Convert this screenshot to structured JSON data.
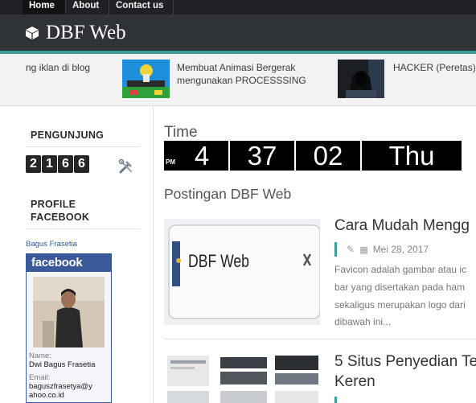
{
  "nav": {
    "items": [
      {
        "label": "Home",
        "active": true
      },
      {
        "label": "About",
        "active": false
      },
      {
        "label": "Contact us",
        "active": false
      }
    ]
  },
  "header": {
    "title": "DBF Web",
    "icon": "cube-icon"
  },
  "slider": {
    "items": [
      {
        "caption": "ng iklan di blog"
      },
      {
        "caption_line1": "Membuat Animasi Bergerak",
        "caption_line2": "mengunakan PROCESSSING"
      },
      {
        "caption": "HACKER (Peretas)"
      }
    ]
  },
  "sidebar": {
    "visitors": {
      "title": "PENGUNJUNG",
      "digits": [
        "2",
        "1",
        "6",
        "6"
      ],
      "icon": "tools-icon"
    },
    "facebook": {
      "title_line1": "PROFILE",
      "title_line2": "FACEBOOK",
      "profile_link": "Bagus Frasetia",
      "badge_header": "facebook",
      "name_label": "Name:",
      "name_value": "Dwi Bagus Frasetia",
      "email_label": "Email:",
      "email_line1": "baguszfrasetya@y",
      "email_line2": "ahoo.co.id"
    }
  },
  "clock": {
    "label": "Time",
    "ampm": "PM",
    "hour": "4",
    "minute": "37",
    "second": "02",
    "day": "Thu"
  },
  "posts": {
    "section_title": "Postingan DBF Web",
    "items": [
      {
        "title": "Cara Mudah Mengg",
        "date": "Mei 28, 2017",
        "thumb_text": "DBF Web",
        "excerpt_lines": [
          "Favicon adalah gambar atau ic",
          "bar yang disertakan pada ham",
          "sekaligus merupakan logo dari",
          "dibawah ini..."
        ]
      },
      {
        "title_line1": "5 Situs Penyedian Te",
        "title_line2": "Keren"
      }
    ]
  },
  "colors": {
    "accent": "#3a9c93",
    "header_bg": "#2f3336",
    "nav_bg": "#1f2124",
    "facebook": "#3b5998"
  }
}
